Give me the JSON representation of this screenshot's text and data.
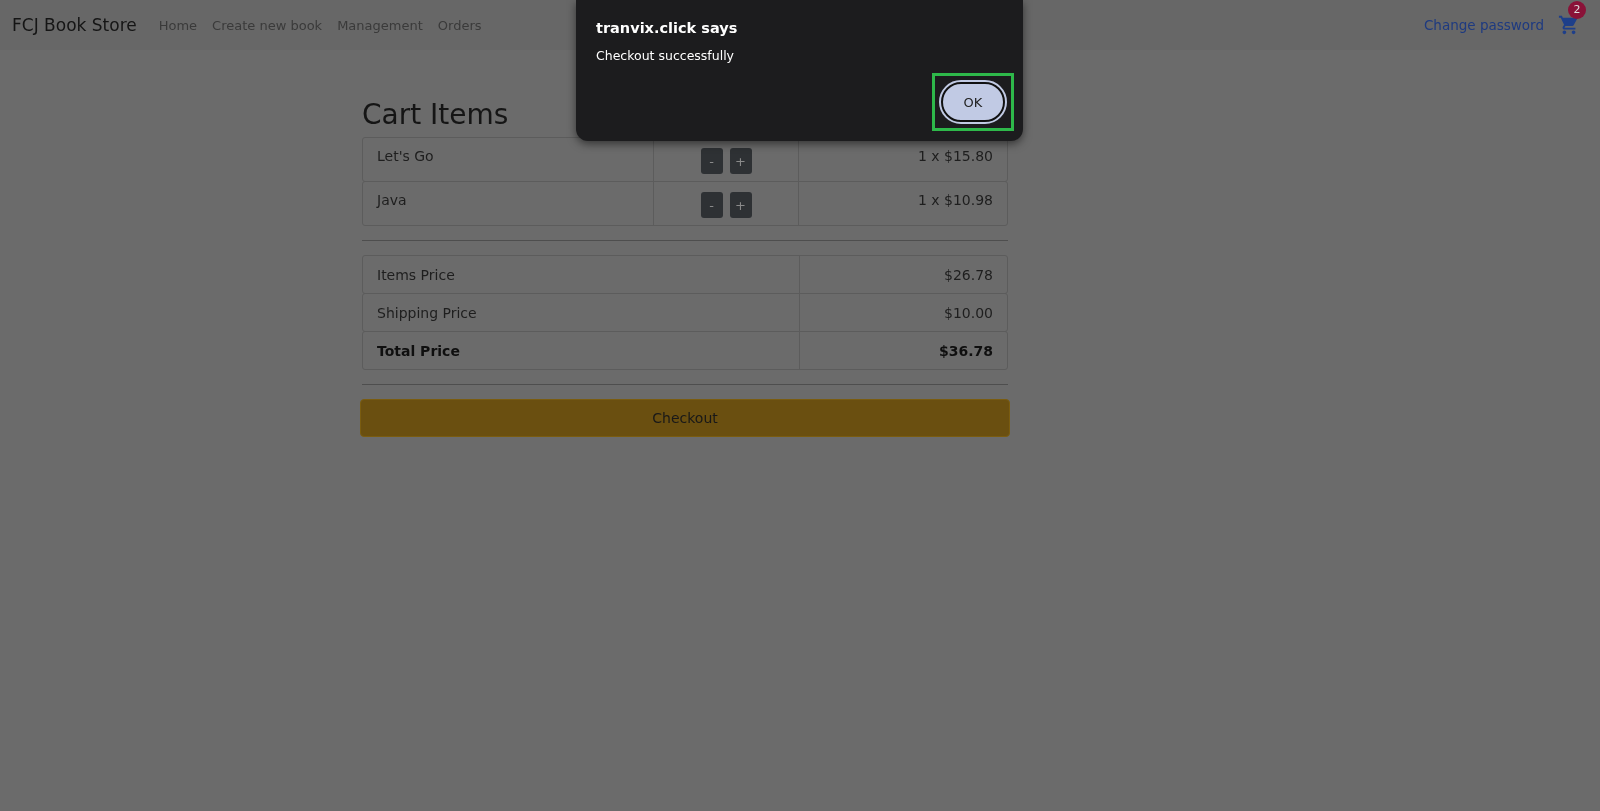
{
  "navbar": {
    "brand": "FCJ Book Store",
    "links": [
      "Home",
      "Create new book",
      "Management",
      "Orders"
    ],
    "change_password": "Change password",
    "cart_count": "2"
  },
  "cart": {
    "title": "Cart Items",
    "items": [
      {
        "name": "Let's Go",
        "minus": "-",
        "plus": "+",
        "amount": "1 x $15.80"
      },
      {
        "name": "Java",
        "minus": "-",
        "plus": "+",
        "amount": "1 x $10.98"
      }
    ],
    "summary": [
      {
        "kind": "normal",
        "label": "Items Price",
        "value": "$26.78"
      },
      {
        "kind": "normal",
        "label": "Shipping Price",
        "value": "$10.00"
      },
      {
        "kind": "total",
        "label": "Total Price",
        "value": "$36.78"
      }
    ],
    "checkout_button": "Checkout"
  },
  "dialog": {
    "title": "tranvix.click says",
    "message": "Checkout successfully",
    "ok_button": {
      "label": "OK",
      "focused": true
    }
  }
}
